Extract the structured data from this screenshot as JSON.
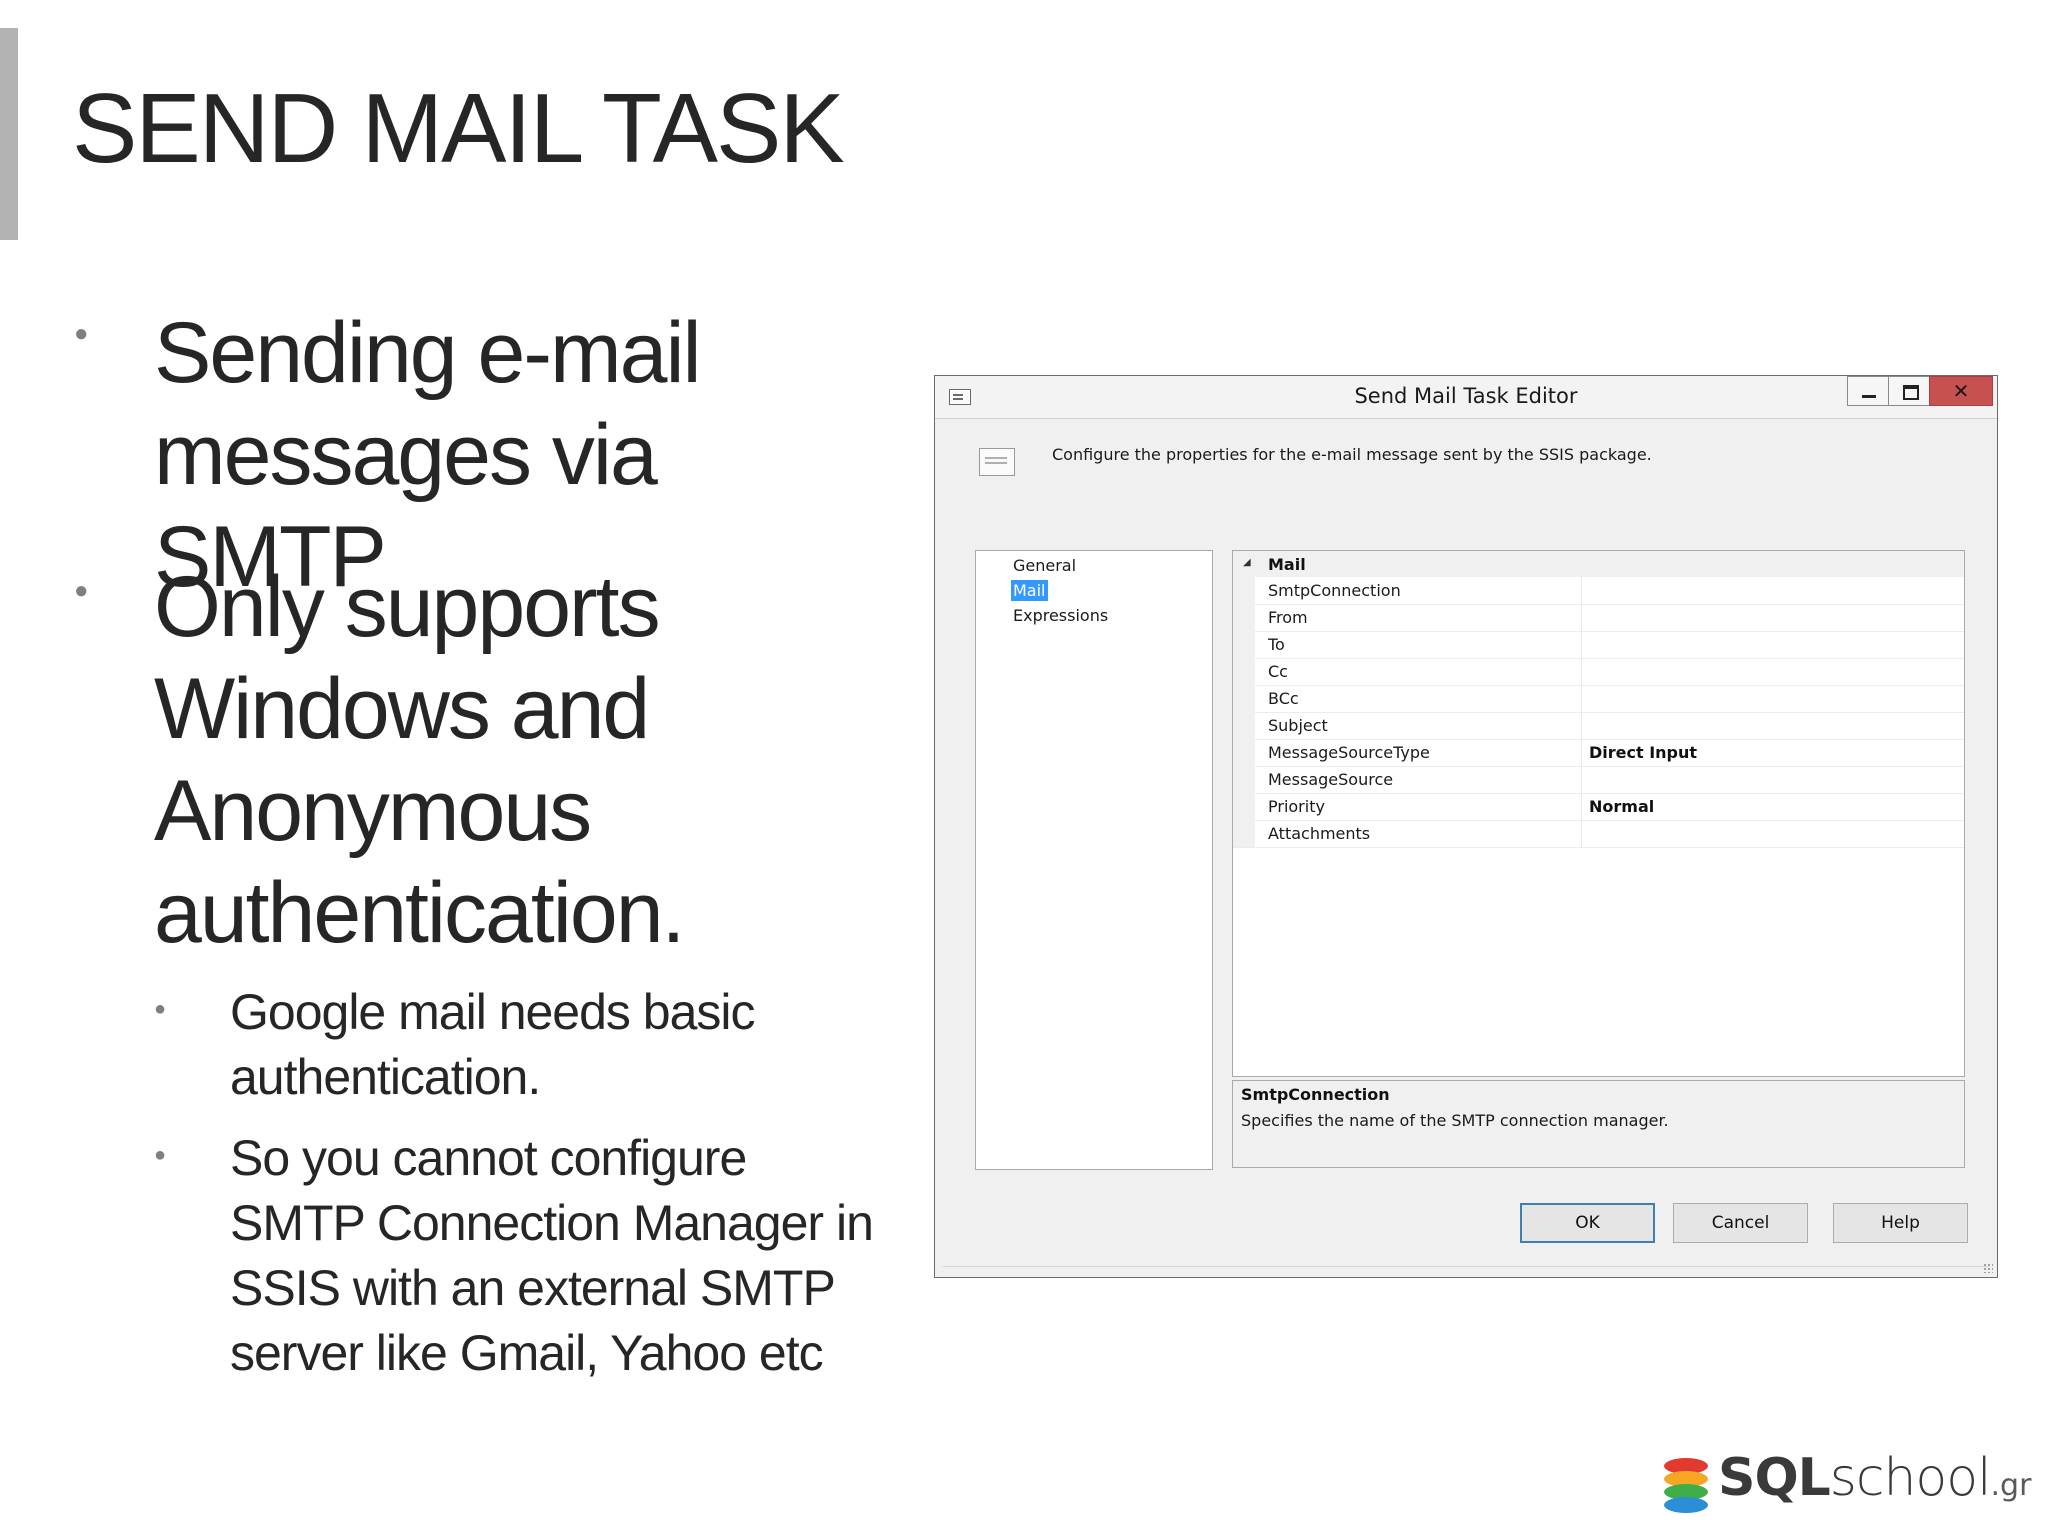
{
  "slide": {
    "title": "SEND MAIL TASK",
    "bullets": [
      {
        "text": "Sending e-mail messages via SMTP"
      },
      {
        "text": "Only supports Windows and Anonymous authentication."
      }
    ],
    "subbullets": [
      {
        "text": "Google mail needs basic authentication."
      },
      {
        "text": "So you cannot configure SMTP Connection Manager in SSIS with an external SMTP server like Gmail, Yahoo etc"
      }
    ]
  },
  "dialog": {
    "title": "Send Mail Task Editor",
    "close_glyph": "✕",
    "header_text": "Configure the properties for the e-mail message sent by the SSIS package.",
    "nav": [
      {
        "label": "General",
        "selected": false
      },
      {
        "label": "Mail",
        "selected": true
      },
      {
        "label": "Expressions",
        "selected": false
      }
    ],
    "grid": {
      "category": "Mail",
      "rows": [
        {
          "name": "SmtpConnection",
          "value": ""
        },
        {
          "name": "From",
          "value": ""
        },
        {
          "name": "To",
          "value": ""
        },
        {
          "name": "Cc",
          "value": ""
        },
        {
          "name": "BCc",
          "value": ""
        },
        {
          "name": "Subject",
          "value": ""
        },
        {
          "name": "MessageSourceType",
          "value": "Direct Input"
        },
        {
          "name": "MessageSource",
          "value": ""
        },
        {
          "name": "Priority",
          "value": "Normal"
        },
        {
          "name": "Attachments",
          "value": ""
        }
      ]
    },
    "help_title": "SmtpConnection",
    "help_desc": "Specifies the name of the SMTP connection manager.",
    "buttons": {
      "ok": "OK",
      "cancel": "Cancel",
      "help": "Help"
    }
  },
  "logo": {
    "sql": "SQL",
    "school": "school",
    "gr": ".gr",
    "colors": [
      "#e23a2e",
      "#f5a623",
      "#3fae49",
      "#2a8fd6"
    ]
  }
}
